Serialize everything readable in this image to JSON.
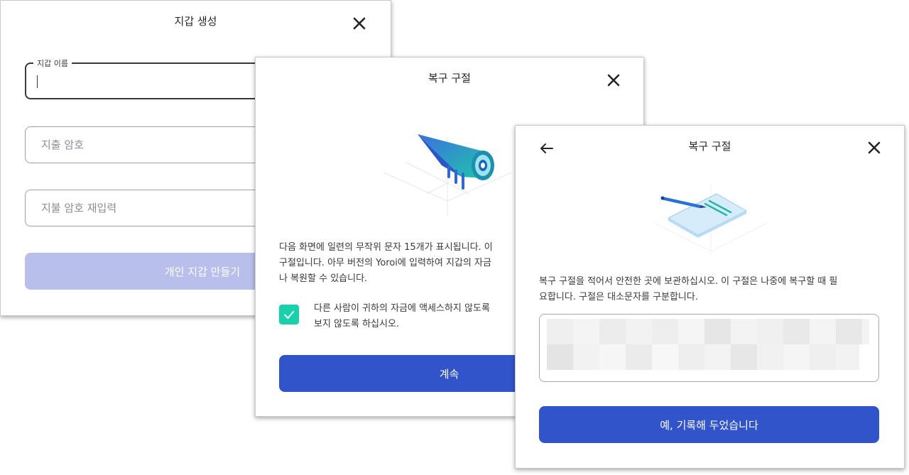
{
  "create_wallet_dialog": {
    "title": "지갑 생성",
    "wallet_name_label": "지갑 이름",
    "wallet_name_value": "",
    "spending_password_placeholder": "지출 암호",
    "repeat_password_placeholder": "지불 암호 재입력",
    "create_button_label": "개인 지갑 만들기"
  },
  "recovery_phrase_intro_dialog": {
    "title": "복구 구절",
    "paragraph_lines": [
      "다음 화면에 일련의 무작위 문자 15개가 표시됩니다. 이",
      "구절입니다. 아무 버전의 Yoroi에 입력하여 지갑의 자금",
      "나 복원할 수 있습니다."
    ],
    "checkbox_checked": true,
    "checkbox_label_lines": [
      "다른 사람이 귀하의 자금에 액세스하지 않도록",
      "보지 않도록 하십시오."
    ],
    "continue_button_label": "계속"
  },
  "recovery_phrase_write_dialog": {
    "title": "복구 구절",
    "paragraph_lines": [
      "복구 구절을 적어서 안전한 곳에 보관하십시오. 이 구절은 나중에 복구할 때 필",
      "요합니다. 구절은 대소문자를 구분합니다."
    ],
    "confirm_button_label": "예, 기록해 두었습니다"
  },
  "icons": {
    "close": "close-icon",
    "back": "back-arrow-icon",
    "checkbox": "checkmark-icon",
    "illustration_telescope": "telescope-illustration",
    "illustration_notepad": "notepad-pen-illustration"
  },
  "colors": {
    "primary_button": "#3154cb",
    "disabled_button": "#b7bfea",
    "checkbox": "#17d1aa"
  }
}
